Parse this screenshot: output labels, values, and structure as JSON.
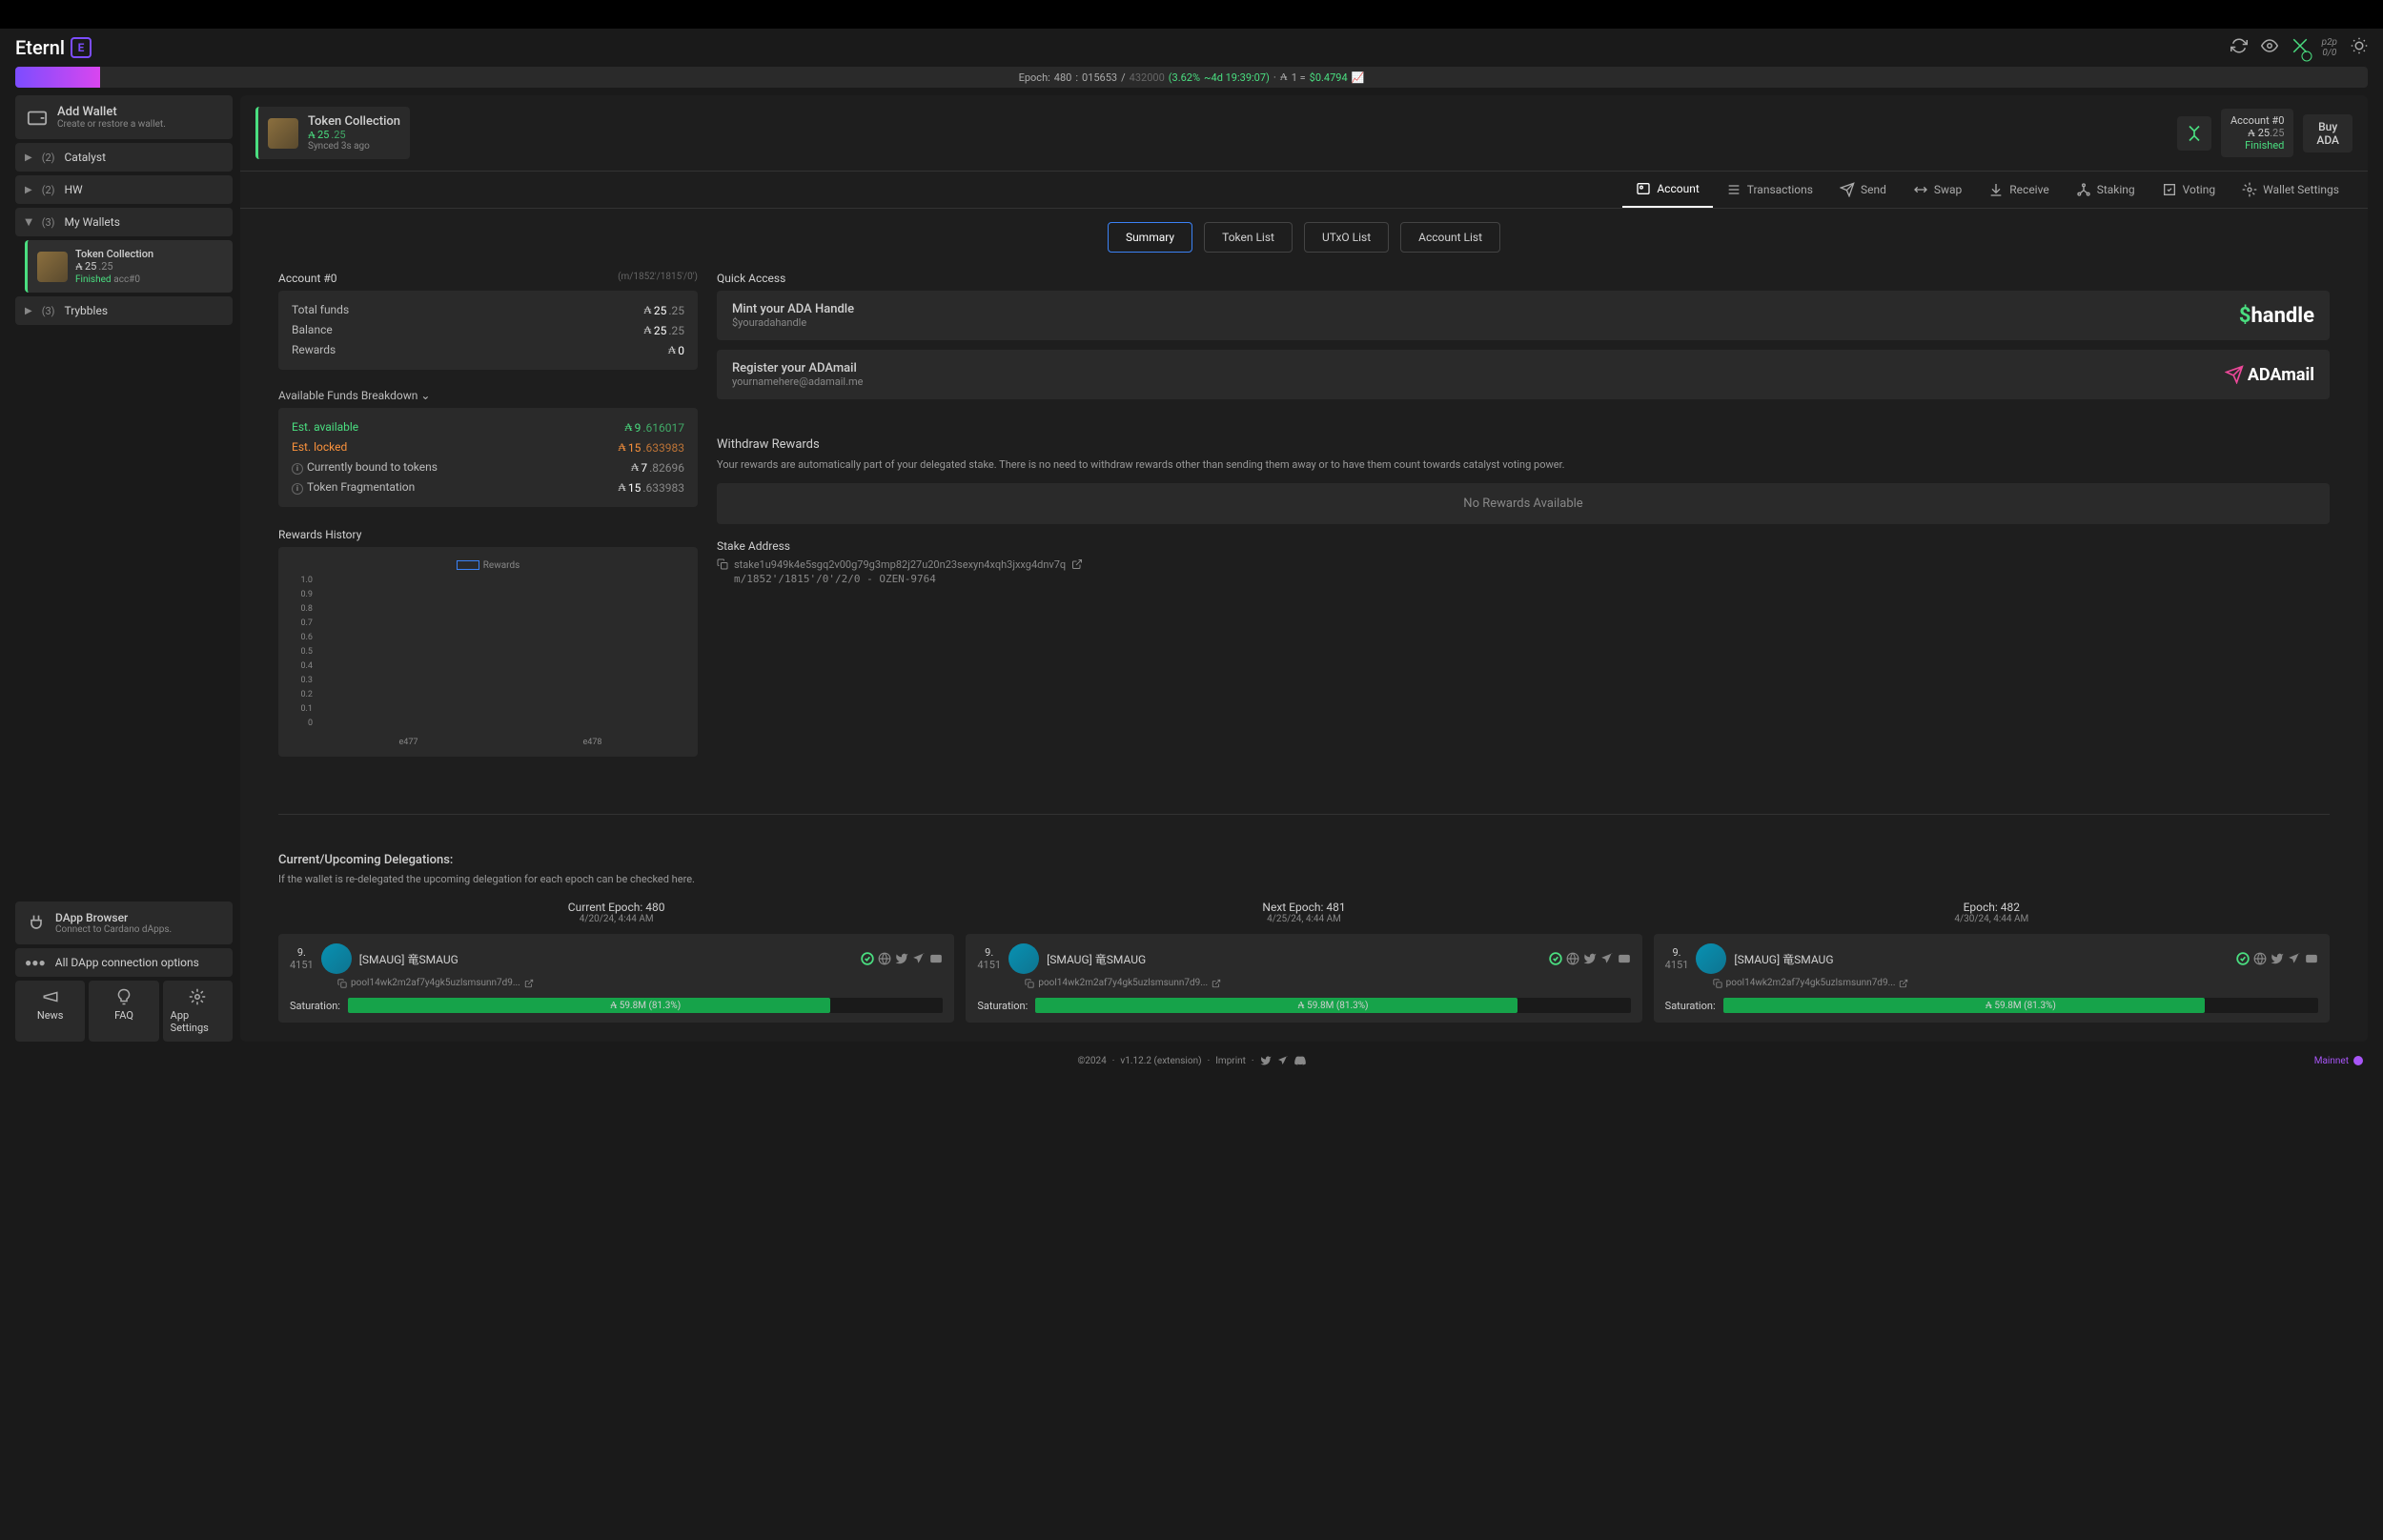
{
  "logo": "Eternl",
  "p2p": {
    "label": "p2p",
    "count": "0/0"
  },
  "epoch": {
    "label": "Epoch:",
    "number": "480",
    "progress": "015653",
    "total": "432000",
    "pct": "(3.62%",
    "remain": "~4d 19:39:07)",
    "sep": "·",
    "rate_prefix": "1 =",
    "rate": "$0.4794"
  },
  "sidebar": {
    "add_wallet": {
      "title": "Add Wallet",
      "desc": "Create or restore a wallet."
    },
    "items": [
      {
        "count": "(2)",
        "label": "Catalyst"
      },
      {
        "count": "(2)",
        "label": "HW"
      },
      {
        "count": "(3)",
        "label": "My Wallets"
      },
      {
        "count": "(3)",
        "label": "Trybbles"
      }
    ],
    "active_wallet": {
      "name": "Token Collection",
      "bal_int": "25",
      "bal_dec": ".25",
      "status": "Finished",
      "acc": "acc#0"
    },
    "dapp": {
      "title": "DApp Browser",
      "desc": "Connect to Cardano dApps."
    },
    "conn": "All DApp connection options",
    "btns": {
      "news": "News",
      "faq": "FAQ",
      "settings": "App Settings"
    }
  },
  "wallet_header": {
    "name": "Token Collection",
    "bal_int": "25",
    "bal_dec": ".25",
    "synced": "Synced 3s ago"
  },
  "account_chip": {
    "name": "Account #0",
    "bal_int": "25",
    "bal_dec": ".25",
    "status": "Finished"
  },
  "buy": {
    "line1": "Buy",
    "line2": "ADA"
  },
  "tabs": [
    "Account",
    "Transactions",
    "Send",
    "Swap",
    "Receive",
    "Staking",
    "Voting",
    "Wallet Settings"
  ],
  "subtabs": [
    "Summary",
    "Token List",
    "UTxO List",
    "Account List"
  ],
  "account_title": "Account #0",
  "account_path": "(m/1852'/1815'/0')",
  "funds": {
    "total": {
      "label": "Total funds",
      "int": "25",
      "dec": ".25"
    },
    "balance": {
      "label": "Balance",
      "int": "25",
      "dec": ".25"
    },
    "rewards": {
      "label": "Rewards",
      "int": "0"
    }
  },
  "breakdown_label": "Available Funds Breakdown",
  "breakdown": {
    "avail": {
      "label": "Est. available",
      "int": "9",
      "dec": ".616017"
    },
    "locked": {
      "label": "Est. locked",
      "int": "15",
      "dec": ".633983"
    },
    "bound": {
      "label": "Currently bound to tokens",
      "int": "7",
      "dec": ".82696"
    },
    "frag": {
      "label": "Token Fragmentation",
      "int": "15",
      "dec": ".633983"
    }
  },
  "quick_access": "Quick Access",
  "quick": {
    "handle": {
      "title": "Mint your ADA Handle",
      "desc": "$youradahandle",
      "logo": "handle"
    },
    "adamail": {
      "title": "Register your ADAmail",
      "desc": "yournamehere@adamail.me",
      "logo": "ADAmail"
    }
  },
  "rewards_history": "Rewards History",
  "chart_legend": "Rewards",
  "chart_data": {
    "type": "bar",
    "title": "Rewards History",
    "categories": [
      "e477",
      "e478"
    ],
    "values": [
      0,
      0
    ],
    "ylim": [
      0,
      1.0
    ],
    "yticks": [
      "1.0",
      "0.9",
      "0.8",
      "0.7",
      "0.6",
      "0.5",
      "0.4",
      "0.3",
      "0.2",
      "0.1",
      "0"
    ],
    "xlabel": "",
    "ylabel": ""
  },
  "withdraw": {
    "title": "Withdraw Rewards",
    "desc": "Your rewards are automatically part of your delegated stake. There is no need to withdraw rewards other than sending them away or to have them count towards catalyst voting power.",
    "none": "No Rewards Available"
  },
  "stake": {
    "title": "Stake Address",
    "addr": "stake1u949k4e5sgq2v00g79g3mp82j27u20n23sexyn4xqh3jxxg4dnv7q",
    "path": "m/1852'/1815'/0'/2/0 - OZEN-9764"
  },
  "delegations": {
    "title": "Current/Upcoming Delegations:",
    "desc": "If the wallet is re-delegated the upcoming delegation for each epoch can be checked here.",
    "cards": [
      {
        "epoch": "Current Epoch: 480",
        "date": "4/20/24, 4:44 AM",
        "rank": "9.",
        "rank2": "4151",
        "name": "[SMAUG] 竜SMAUG",
        "pool": "pool14wk2m2af7y4gk5uzlsmsunn7d9...",
        "sat_label": "Saturation:",
        "sat": "59.8M (81.3%)"
      },
      {
        "epoch": "Next Epoch: 481",
        "date": "4/25/24, 4:44 AM",
        "rank": "9.",
        "rank2": "4151",
        "name": "[SMAUG] 竜SMAUG",
        "pool": "pool14wk2m2af7y4gk5uzlsmsunn7d9...",
        "sat_label": "Saturation:",
        "sat": "59.8M (81.3%)"
      },
      {
        "epoch": "Epoch: 482",
        "date": "4/30/24, 4:44 AM",
        "rank": "9.",
        "rank2": "4151",
        "name": "[SMAUG] 竜SMAUG",
        "pool": "pool14wk2m2af7y4gk5uzlsmsunn7d9...",
        "sat_label": "Saturation:",
        "sat": "59.8M (81.3%)"
      }
    ]
  },
  "footer": {
    "copy": "©2024",
    "sep": "·",
    "ver": "v1.12.2 (extension)",
    "imprint": "Imprint",
    "mainnet": "Mainnet"
  }
}
